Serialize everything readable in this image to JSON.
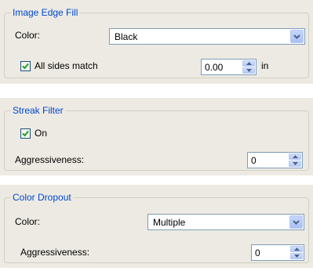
{
  "image_edge_fill": {
    "title": "Image Edge Fill",
    "color_label": "Color:",
    "color_value": "Black",
    "all_sides_label": "All sides match",
    "all_sides_checked": true,
    "size_value": "0.00",
    "unit": "in"
  },
  "streak_filter": {
    "title": "Streak Filter",
    "on_label": "On",
    "on_checked": true,
    "aggressiveness_label": "Aggressiveness:",
    "aggressiveness_value": "0"
  },
  "color_dropout": {
    "title": "Color Dropout",
    "color_label": "Color:",
    "color_value": "Multiple",
    "aggressiveness_label": "Aggressiveness:",
    "aggressiveness_value": "0"
  },
  "colors": {
    "group_title": "#0046d5",
    "panel_bg": "#eceae2",
    "check": "#21a121"
  }
}
